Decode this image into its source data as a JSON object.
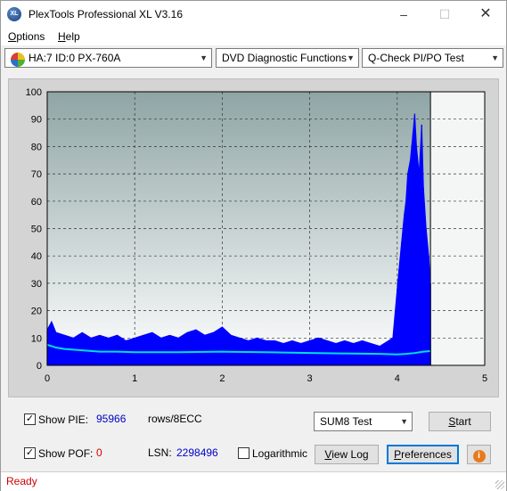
{
  "window": {
    "title": "PlexTools Professional XL V3.16",
    "app_icon_text": "XL"
  },
  "menu": [
    {
      "label": "Options",
      "accel": "O"
    },
    {
      "label": "Help",
      "accel": "H"
    }
  ],
  "toolbar": {
    "drive": "HA:7 ID:0  PX-760A",
    "function": "DVD Diagnostic Functions",
    "test": "Q-Check PI/PO Test"
  },
  "chart_data": {
    "type": "area",
    "xlim": [
      0,
      5
    ],
    "ylim": [
      0,
      100
    ],
    "x_ticks": [
      "0",
      "1",
      "2",
      "3",
      "4",
      "5"
    ],
    "y_ticks": [
      "0",
      "10",
      "20",
      "30",
      "40",
      "50",
      "60",
      "70",
      "80",
      "90",
      "100"
    ],
    "grid": true,
    "end_marker_x": 4.38,
    "series": [
      {
        "kind": "pie-bars",
        "color": "#0000ff",
        "x": [
          0,
          0.05,
          0.1,
          0.2,
          0.3,
          0.4,
          0.5,
          0.6,
          0.7,
          0.8,
          0.9,
          1.0,
          1.1,
          1.2,
          1.3,
          1.4,
          1.5,
          1.6,
          1.7,
          1.8,
          1.9,
          2.0,
          2.1,
          2.2,
          2.3,
          2.4,
          2.5,
          2.6,
          2.7,
          2.8,
          2.9,
          3.0,
          3.1,
          3.2,
          3.3,
          3.4,
          3.5,
          3.6,
          3.7,
          3.8,
          3.9,
          3.95,
          4.0,
          4.02,
          4.05,
          4.08,
          4.1,
          4.12,
          4.15,
          4.18,
          4.2,
          4.22,
          4.25,
          4.28,
          4.3,
          4.33,
          4.36,
          4.38
        ],
        "values": [
          13,
          16,
          12,
          11,
          10,
          12,
          10,
          11,
          10,
          11,
          9,
          10,
          11,
          12,
          10,
          11,
          10,
          12,
          13,
          11,
          12,
          14,
          11,
          10,
          9,
          10,
          9,
          9,
          8,
          9,
          8,
          9,
          10,
          9,
          8,
          9,
          8,
          9,
          8,
          7,
          9,
          10,
          28,
          35,
          45,
          55,
          60,
          70,
          75,
          85,
          92,
          80,
          70,
          88,
          65,
          50,
          40,
          30
        ]
      },
      {
        "kind": "pie-max-line",
        "color": "#00e0e0",
        "x": [
          0,
          0.1,
          0.2,
          0.4,
          0.6,
          0.8,
          1.0,
          1.5,
          2.0,
          2.5,
          3.0,
          3.5,
          3.8,
          4.0,
          4.1,
          4.2,
          4.3,
          4.38
        ],
        "values": [
          7.5,
          6.5,
          6.0,
          5.5,
          5.0,
          5.0,
          4.8,
          4.8,
          5.0,
          4.8,
          4.5,
          4.3,
          4.2,
          4.0,
          4.2,
          4.5,
          5.0,
          5.2
        ]
      }
    ]
  },
  "bottom": {
    "show_pie_label": "Show PIE:",
    "show_pie_checked": true,
    "pie_value": "95966",
    "rows_label": "rows/8ECC",
    "show_pof_label": "Show POF:",
    "show_pof_checked": true,
    "pof_value": "0",
    "lsn_label": "LSN:",
    "lsn_value": "2298496",
    "logarithmic_label": "Logarithmic",
    "logarithmic_checked": false,
    "test_select": "SUM8 Test",
    "start_button": "Start",
    "view_log_button": "View Log",
    "preferences_button": "Preferences",
    "info_icon": "i"
  },
  "status": {
    "text": "Ready"
  },
  "colors": {
    "pie": "#0000ff",
    "line": "#00e0e0",
    "status_red": "#d00000",
    "value_blue": "#0000c8"
  }
}
